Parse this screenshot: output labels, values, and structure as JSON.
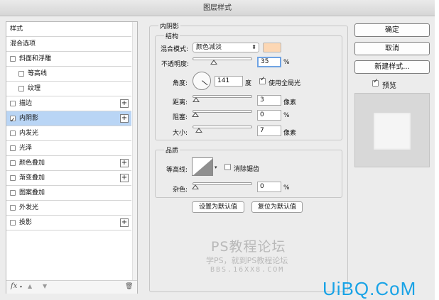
{
  "window": {
    "title": "图层样式"
  },
  "left_panel": {
    "items": [
      {
        "label": "样式",
        "checkbox": false,
        "checked": false,
        "plus": false,
        "indent": 0,
        "selected": false
      },
      {
        "label": "混合选项",
        "checkbox": false,
        "checked": false,
        "plus": false,
        "indent": 0,
        "selected": false
      },
      {
        "label": "斜面和浮雕",
        "checkbox": true,
        "checked": false,
        "plus": false,
        "indent": 0,
        "selected": false
      },
      {
        "label": "等高线",
        "checkbox": true,
        "checked": false,
        "plus": false,
        "indent": 1,
        "selected": false
      },
      {
        "label": "纹理",
        "checkbox": true,
        "checked": false,
        "plus": false,
        "indent": 1,
        "selected": false
      },
      {
        "label": "描边",
        "checkbox": true,
        "checked": false,
        "plus": true,
        "indent": 0,
        "selected": false
      },
      {
        "label": "内阴影",
        "checkbox": true,
        "checked": true,
        "plus": true,
        "indent": 0,
        "selected": true
      },
      {
        "label": "内发光",
        "checkbox": true,
        "checked": false,
        "plus": false,
        "indent": 0,
        "selected": false
      },
      {
        "label": "光泽",
        "checkbox": true,
        "checked": false,
        "plus": false,
        "indent": 0,
        "selected": false
      },
      {
        "label": "颜色叠加",
        "checkbox": true,
        "checked": false,
        "plus": true,
        "indent": 0,
        "selected": false
      },
      {
        "label": "渐变叠加",
        "checkbox": true,
        "checked": false,
        "plus": true,
        "indent": 0,
        "selected": false
      },
      {
        "label": "图案叠加",
        "checkbox": true,
        "checked": false,
        "plus": false,
        "indent": 0,
        "selected": false
      },
      {
        "label": "外发光",
        "checkbox": true,
        "checked": false,
        "plus": false,
        "indent": 0,
        "selected": false
      },
      {
        "label": "投影",
        "checkbox": true,
        "checked": false,
        "plus": true,
        "indent": 0,
        "selected": false
      }
    ],
    "footer": {
      "fx": "fx",
      "fx_arrow": "▾",
      "up": "▲",
      "down": "▼",
      "trash": "🗑"
    }
  },
  "inner_shadow": {
    "section_title": "内阴影",
    "structure": {
      "title": "结构",
      "blend_mode_label": "混合模式:",
      "blend_mode_value": "颜色减淡",
      "blend_color": "#fcd7b4",
      "opacity_label": "不透明度:",
      "opacity_value": "35",
      "opacity_unit": "%",
      "opacity_level": 0.35,
      "angle_label": "角度:",
      "angle_value": "141",
      "angle_unit": "度",
      "use_global_light_label": "使用全局光",
      "use_global_light_checked": true,
      "distance_label": "距离:",
      "distance_value": "3",
      "distance_unit": "像素",
      "choke_label": "阻塞:",
      "choke_value": "0",
      "choke_unit": "%",
      "size_label": "大小:",
      "size_value": "7",
      "size_unit": "像素"
    },
    "quality": {
      "title": "品质",
      "contour_label": "等高线:",
      "anti_alias_label": "消除锯齿",
      "anti_alias_checked": false,
      "noise_label": "杂色:",
      "noise_value": "0",
      "noise_unit": "%"
    },
    "make_default_label": "设置为默认值",
    "reset_default_label": "复位为默认值"
  },
  "right_panel": {
    "ok_label": "确定",
    "cancel_label": "取消",
    "new_style_label": "新建样式...",
    "preview_label": "预览",
    "preview_checked": true
  },
  "watermark": {
    "line1": "PS教程论坛",
    "line2": "学PS，就到PS教程论坛",
    "line3": "BBS.16XX8.COM",
    "brand": "UiBQ.CoM"
  }
}
